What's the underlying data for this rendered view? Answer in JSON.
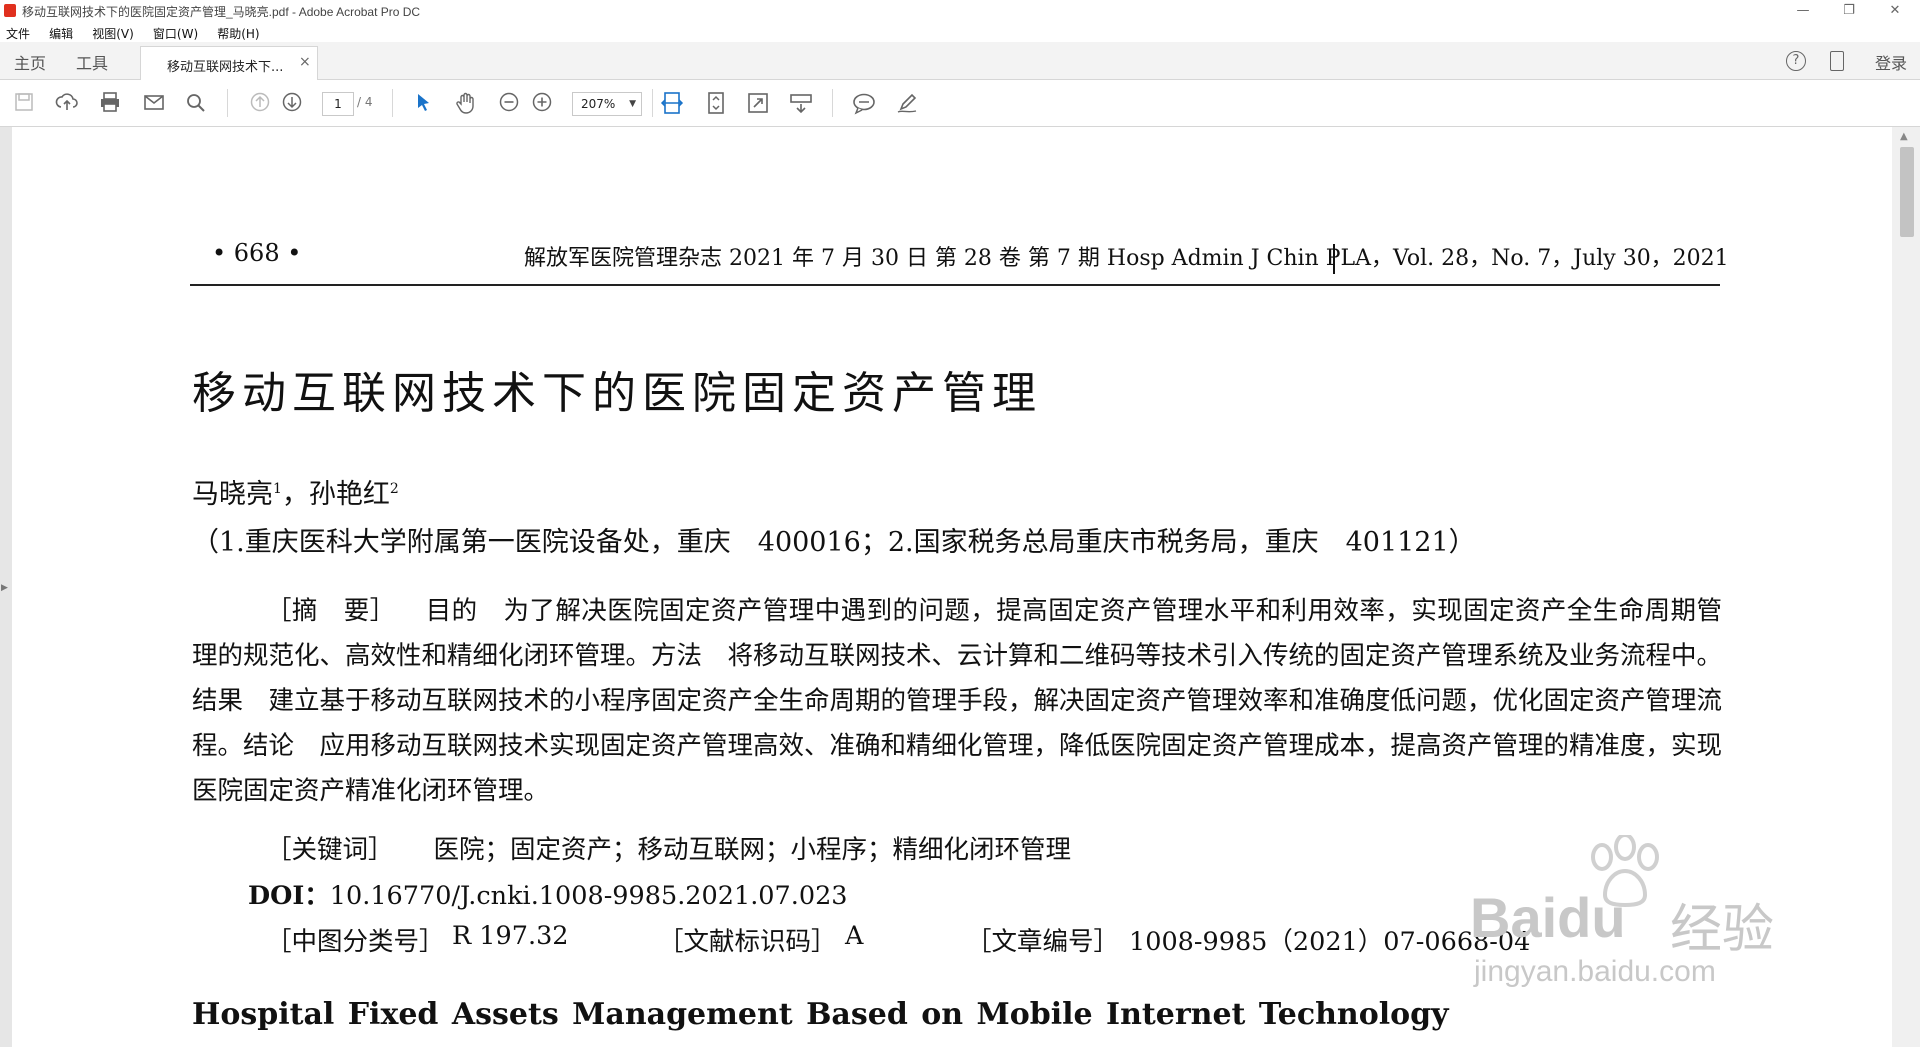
{
  "window": {
    "title": "移动互联网技术下的医院固定资产管理_马晓亮.pdf - Adobe Acrobat Pro DC",
    "minimize_glyph": "—",
    "restore_glyph": "❐",
    "close_glyph": "✕"
  },
  "menu": [
    "文件",
    "编辑",
    "视图(V)",
    "窗口(W)",
    "帮助(H)"
  ],
  "tabs": {
    "home": "主页",
    "tools": "工具",
    "document": "移动互联网技术下...",
    "close": "×",
    "help": "?",
    "login": "登录"
  },
  "toolbar": {
    "current_page": "1",
    "total_pages": "/ 4",
    "zoom": "207%",
    "icons": [
      "save-icon",
      "upload-cloud-icon",
      "print-icon",
      "email-icon",
      "search-icon",
      "page-up-icon",
      "page-down-icon",
      "select-pointer-icon",
      "hand-tool-icon",
      "zoom-out-icon",
      "zoom-in-icon",
      "fit-width-icon",
      "fit-page-icon",
      "full-screen-icon",
      "read-mode-icon",
      "comment-icon",
      "sign-icon"
    ]
  },
  "document": {
    "page_number": "• 668 •",
    "journal_header": "解放军医院管理杂志 2021 年 7 月 30 日 第 28 卷 第 7 期 Hosp Admin J Chin PLA，Vol. 28，No. 7，July 30，2021",
    "title": "移动互联网技术下的医院固定资产管理",
    "author1": "马晓亮",
    "author1_sup": "1",
    "author_sep": "，孙艳红",
    "author2_sup": "2",
    "affiliation": "（1.重庆医科大学附属第一医院设备处，重庆　400016；2.国家税务总局重庆市税务局，重庆　401121）",
    "abstract_tag": "［摘　要］",
    "abstract_text": "目的　为了解决医院固定资产管理中遇到的问题，提高固定资产管理水平和利用效率，实现固定资产全生命周期管理的规范化、高效性和精细化闭环管理。方法　将移动互联网技术、云计算和二维码等技术引入传统的固定资产管理系统及业务流程中。结果　建立基于移动互联网技术的小程序固定资产全生命周期的管理手段，解决固定资产管理效率和准确度低问题，优化固定资产管理流程。结论　应用移动互联网技术实现固定资产管理高效、准确和精细化管理，降低医院固定资产管理成本，提高资产管理的精准度，实现医院固定资产精准化闭环管理。",
    "keywords_tag": "［关键词］",
    "keywords": "医院；固定资产；移动互联网；小程序；精细化闭环管理",
    "doi_label": "DOI：",
    "doi": "10.16770/J.cnki.1008-9985.2021.07.023",
    "clc_label": "［中图分类号］",
    "clc": "R 197.32",
    "doc_code_label": "［文献标识码］",
    "doc_code": "A",
    "article_no_label": "［文章编号］",
    "article_no": "1008-9985（2021）07-0668-04",
    "english_title": "Hospital Fixed Assets Management Based on Mobile Internet Technology"
  },
  "watermark": {
    "brand": "Baidu",
    "cn": "经验",
    "url": "jingyan.baidu.com"
  }
}
